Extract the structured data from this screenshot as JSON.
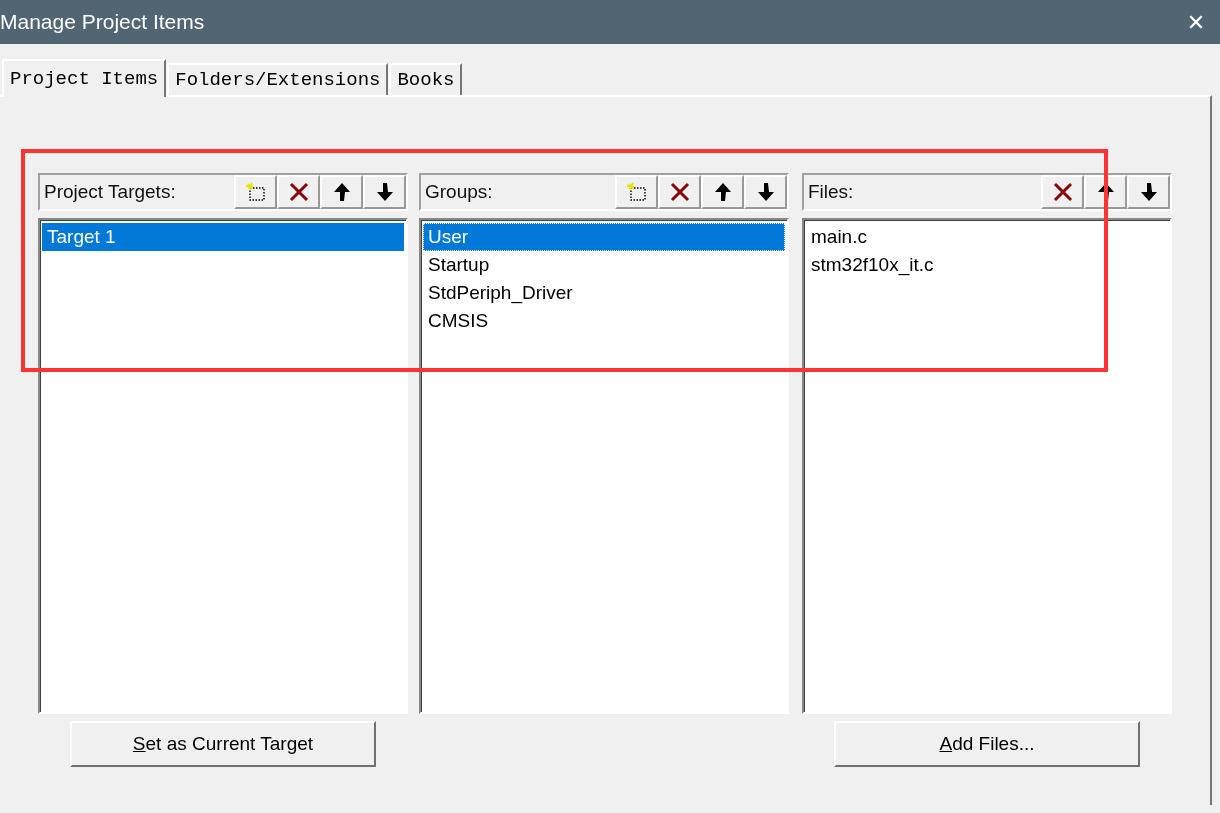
{
  "window": {
    "title": "Manage Project Items",
    "close": "✕"
  },
  "tabs": [
    {
      "label": "Project Items",
      "selected": true
    },
    {
      "label": "Folders/Extensions",
      "selected": false
    },
    {
      "label": "Books",
      "selected": false
    }
  ],
  "columns": [
    {
      "label": "Project Targets:",
      "tools": [
        {
          "kind": "new"
        },
        {
          "kind": "delete"
        },
        {
          "kind": "up"
        },
        {
          "kind": "down"
        }
      ],
      "items": [
        {
          "label": "Target 1",
          "selected": true,
          "focused": false
        }
      ],
      "button": "Set as Current Target"
    },
    {
      "label": "Groups:",
      "tools": [
        {
          "kind": "new"
        },
        {
          "kind": "delete"
        },
        {
          "kind": "up"
        },
        {
          "kind": "down"
        }
      ],
      "items": [
        {
          "label": "User",
          "selected": true,
          "focused": true
        },
        {
          "label": "Startup",
          "selected": false,
          "focused": false
        },
        {
          "label": "StdPeriph_Driver",
          "selected": false,
          "focused": false
        },
        {
          "label": "CMSIS",
          "selected": false,
          "focused": false
        }
      ]
    },
    {
      "label": "Files:",
      "tools": [
        {
          "kind": "delete"
        },
        {
          "kind": "up"
        },
        {
          "kind": "down"
        }
      ],
      "items": [
        {
          "label": "main.c",
          "selected": false,
          "focused": false
        },
        {
          "label": "stm32f10x_it.c",
          "selected": false,
          "focused": false
        }
      ],
      "button": "Add Files..."
    }
  ]
}
